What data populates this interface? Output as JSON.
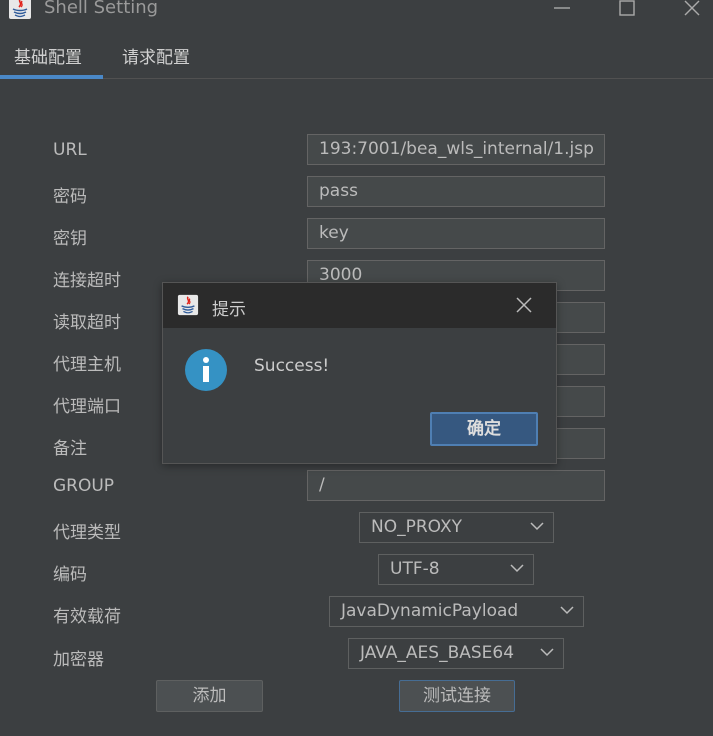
{
  "window": {
    "title": "Shell Setting"
  },
  "tabs": [
    {
      "label": "基础配置",
      "active": true
    },
    {
      "label": "请求配置",
      "active": false
    }
  ],
  "form": {
    "url_label": "URL",
    "url_value": "193:7001/bea_wls_internal/1.jsp",
    "password_label": "密码",
    "password_value": "pass",
    "key_label": "密钥",
    "key_value": "key",
    "connect_timeout_label": "连接超时",
    "connect_timeout_value": "3000",
    "read_timeout_label": "读取超时",
    "read_timeout_value": "",
    "proxy_host_label": "代理主机",
    "proxy_host_value": "",
    "proxy_port_label": "代理端口",
    "proxy_port_value": "",
    "remark_label": "备注",
    "remark_value": "",
    "group_label": "GROUP",
    "group_value": "/",
    "proxy_type_label": "代理类型",
    "proxy_type_value": "NO_PROXY",
    "encoding_label": "编码",
    "encoding_value": "UTF-8",
    "payload_label": "有效载荷",
    "payload_value": "JavaDynamicPayload",
    "encryptor_label": "加密器",
    "encryptor_value": "JAVA_AES_BASE64"
  },
  "buttons": {
    "add": "添加",
    "test": "测试连接"
  },
  "dialog": {
    "title": "提示",
    "message": "Success!",
    "ok": "确定"
  },
  "colors": {
    "background": "#3c3f41",
    "accent": "#4a88c7",
    "info_icon": "#3592c4"
  },
  "icons": [
    "java-app-icon",
    "minimize-icon",
    "maximize-icon",
    "close-icon",
    "info-icon",
    "chevron-down-icon"
  ]
}
